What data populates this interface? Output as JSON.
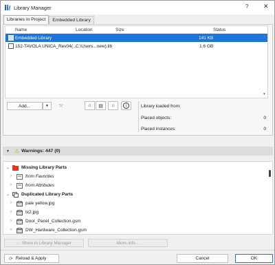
{
  "window": {
    "title": "Library Manager",
    "help": "?",
    "close": "✕"
  },
  "tabs": [
    {
      "label": "Libraries in Project"
    },
    {
      "label": "Embedded Library"
    }
  ],
  "columns": {
    "name": "Name",
    "location": "Location",
    "size": "Size",
    "status": "Status"
  },
  "libraries": [
    {
      "name": "Embedded Library",
      "location": "",
      "size": "141 KB",
      "status": ""
    },
    {
      "name": "152-TAVOLA UNICA_Rev04(...",
      "location": "C:\\Users...new).lib",
      "size": "1.6 GB",
      "status": ""
    }
  ],
  "buttons": {
    "add": "Add...",
    "show_in_manager": "Show in Library Manager",
    "more_info": "More info...",
    "reload_apply": "Reload & Apply",
    "cancel": "Cancel",
    "ok": "OK"
  },
  "info": {
    "loaded_from_label": "Library loaded from:",
    "placed_objects_label": "Placed objects:",
    "placed_objects_value": "0",
    "placed_instances_label": "Placed instances:",
    "placed_instances_value": "0"
  },
  "warnings": {
    "label": "Warnings: 447 (0)"
  },
  "tree": [
    {
      "label": "Missing Library Parts",
      "style": "bold",
      "level": 0
    },
    {
      "label": "from Favorites",
      "style": "italic",
      "level": 1
    },
    {
      "label": "from Attributes",
      "style": "italic",
      "level": 1
    },
    {
      "label": "Duplicated Library Parts",
      "style": "bold",
      "level": 0
    },
    {
      "label": "pale yellow.jpg",
      "style": "normal",
      "level": 1
    },
    {
      "label": "tx2.jpg",
      "style": "normal",
      "level": 1
    },
    {
      "label": "Door_Panel_Collection.gsm",
      "style": "normal",
      "level": 1
    },
    {
      "label": "DW_Hardware_Collection.gsm",
      "style": "normal",
      "level": 1
    }
  ],
  "colors": {
    "selection": "#1e74d8",
    "missing_folder": "#e03a1e",
    "warning": "#d9a400"
  },
  "icons": {
    "app": "library-manager-icon",
    "warning": "warning-triangle-icon"
  }
}
